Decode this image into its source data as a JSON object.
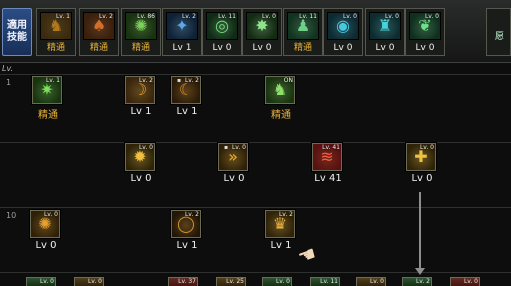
{
  "quickbar": {
    "side_label": "適用\n技能",
    "slots": [
      {
        "level": "Lv. 1",
        "caption": "精通",
        "icon": "gold-figure-icon",
        "glyph": "♞",
        "color": "#b07a1c",
        "bg": "#3b2a0f"
      },
      {
        "level": "Lv. 2",
        "caption": "精通",
        "icon": "flame-figure-icon",
        "glyph": "♠",
        "color": "#d26d2a",
        "bg": "#3a1f0c"
      },
      {
        "level": "Lv. 86",
        "caption": "精通",
        "icon": "green-swirl-icon",
        "glyph": "✺",
        "color": "#7bd25a",
        "bg": "#17330f"
      },
      {
        "level": "Lv. 2",
        "caption": "Lv 1",
        "icon": "blue-dash-icon",
        "glyph": "✦",
        "color": "#5aa9f0",
        "bg": "#0e2136"
      },
      {
        "level": "Lv. 11",
        "caption": "Lv 0",
        "icon": "green-target-icon",
        "glyph": "◎",
        "color": "#6fe07a",
        "bg": "#0f2a15"
      },
      {
        "level": "Lv. 0",
        "caption": "Lv 0",
        "icon": "green-radial-icon",
        "glyph": "✸",
        "color": "#8fe58a",
        "bg": "#122b12"
      },
      {
        "level": "Lv. 11",
        "caption": "精通",
        "icon": "green-fighter-icon",
        "glyph": "♟",
        "color": "#6fd08a",
        "bg": "#103420"
      },
      {
        "level": "Lv. 0",
        "caption": "Lv 0",
        "icon": "cyan-orb-icon",
        "glyph": "◉",
        "color": "#46c8e0",
        "bg": "#0d2a33"
      },
      {
        "level": "Lv. 0",
        "caption": "Lv 0",
        "icon": "cyan-figure-icon",
        "glyph": "♜",
        "color": "#4ad1d8",
        "bg": "#0d2c30"
      },
      {
        "level": "Lv. 0",
        "caption": "Lv 0",
        "icon": "green-leaf-icon",
        "glyph": "❦",
        "color": "#6be28a",
        "bg": "#0f3020"
      }
    ],
    "right_fragment": "愿"
  },
  "tree": {
    "level_header": "Lv.",
    "row_labels": [
      "1",
      "10"
    ],
    "nodes": [
      {
        "level": "Lv. 1",
        "caption": "精通",
        "icon": "green-claw-icon",
        "glyph": "✷",
        "color": "#7be05a",
        "bg": "#18330f",
        "lock": ""
      },
      {
        "level": "Lv. 2",
        "caption": "Lv 1",
        "icon": "gold-crescent-icon",
        "glyph": "☽",
        "color": "#e0a23a",
        "bg": "#3a250c",
        "lock": ""
      },
      {
        "level": "Lv. 2",
        "caption": "Lv 1",
        "icon": "dark-crescent-icon",
        "glyph": "☾",
        "color": "#d9932c",
        "bg": "#2a1a08",
        "lock": "🔒"
      },
      {
        "level": "ON",
        "caption": "精通",
        "icon": "green-stance-icon",
        "glyph": "♞",
        "color": "#8ee06a",
        "bg": "#18330f",
        "lock": ""
      },
      {
        "level": "Lv. 0",
        "caption": "Lv 0",
        "icon": "gold-burst-icon",
        "glyph": "✹",
        "color": "#f0c040",
        "bg": "#2e2308",
        "lock": ""
      },
      {
        "level": "Lv. 0",
        "caption": "Lv 0",
        "icon": "gold-arrows-icon",
        "glyph": "»",
        "color": "#f0b030",
        "bg": "#2e2008",
        "lock": "🔒"
      },
      {
        "level": "Lv. 41",
        "caption": "Lv 41",
        "icon": "red-slash-icon",
        "glyph": "≋",
        "color": "#ff5a3a",
        "bg": "#5a1010",
        "lock": ""
      },
      {
        "level": "Lv. 0",
        "caption": "Lv 0",
        "icon": "gold-shield-icon",
        "glyph": "✚",
        "color": "#f0c040",
        "bg": "#2e2308",
        "lock": ""
      },
      {
        "level": "Lv. 0",
        "caption": "Lv 0",
        "icon": "gold-whirl-icon",
        "glyph": "✺",
        "color": "#e8a030",
        "bg": "#2e2008",
        "lock": ""
      },
      {
        "level": "Lv. 2",
        "caption": "Lv 1",
        "icon": "ring-icon",
        "glyph": "◯",
        "color": "#d08f2a",
        "bg": "#221608",
        "lock": ""
      },
      {
        "level": "Lv. 2",
        "caption": "Lv 1",
        "icon": "gold-strike-icon",
        "glyph": "♛",
        "color": "#e8b040",
        "bg": "#2e2308",
        "lock": ""
      }
    ]
  },
  "bottom_row": [
    {
      "level": "Lv. 0",
      "icon": "green-partial-icon",
      "color": "#6fe07a",
      "bg": "#123012"
    },
    {
      "level": "Lv. 0",
      "icon": "gold-partial-icon",
      "color": "#e0a23a",
      "bg": "#2e2308"
    },
    {
      "level": "Lv. 37",
      "icon": "red-partial-icon",
      "color": "#ff6a4a",
      "bg": "#4a1212"
    },
    {
      "level": "Lv. 25",
      "icon": "gold-partial-icon",
      "color": "#e0a23a",
      "bg": "#2e2308"
    },
    {
      "level": "Lv. 0",
      "icon": "green-partial-icon",
      "color": "#6fe07a",
      "bg": "#123012"
    },
    {
      "level": "Lv. 11",
      "icon": "green-partial-icon",
      "color": "#6fe07a",
      "bg": "#123012"
    },
    {
      "level": "Lv. 0",
      "icon": "gold-partial-icon",
      "color": "#e0a23a",
      "bg": "#2e2308"
    },
    {
      "level": "Lv. 2",
      "icon": "green-partial-icon",
      "color": "#6fe07a",
      "bg": "#123012"
    },
    {
      "level": "Lv. 0",
      "icon": "red-partial-icon",
      "color": "#ff6a4a",
      "bg": "#4a1212"
    },
    {
      "level": "Lv. 0",
      "icon": "green-partial-icon",
      "color": "#6fe07a",
      "bg": "#123012"
    }
  ]
}
